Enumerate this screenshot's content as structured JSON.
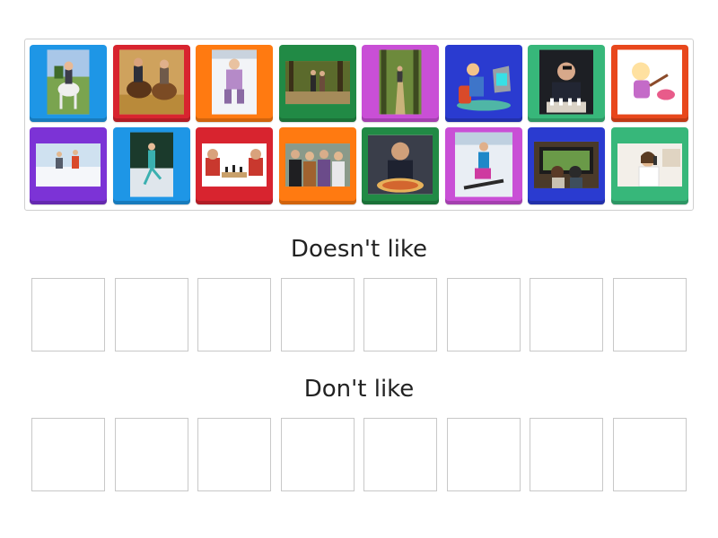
{
  "activity": "Doesn't like / Don't like — group sort",
  "tiles": [
    {
      "name": "tile-horse-riding-girl",
      "icon": "horse-rider-photo-icon",
      "color": "#1e96e6",
      "row": 0
    },
    {
      "name": "tile-horse-riding-couple",
      "icon": "horseback-couple-photo-icon",
      "color": "#d8242f",
      "row": 0
    },
    {
      "name": "tile-ice-skating-child",
      "icon": "ice-skating-child-photo-icon",
      "color": "#ff7a11",
      "row": 0
    },
    {
      "name": "tile-hiking-forest",
      "icon": "forest-hikers-photo-icon",
      "color": "#218a45",
      "row": 0
    },
    {
      "name": "tile-forest-walk",
      "icon": "forest-path-walker-photo-icon",
      "color": "#c94fd6",
      "row": 0
    },
    {
      "name": "tile-cartoon-tv-watcher",
      "icon": "cartoon-tv-couch-icon",
      "color": "#2a3bd0",
      "row": 0
    },
    {
      "name": "tile-chess-player-man",
      "icon": "chess-player-photo-icon",
      "color": "#37b77a",
      "row": 0
    },
    {
      "name": "tile-cartoon-painting-girl",
      "icon": "cartoon-painting-girl-icon",
      "color": "#e8471c",
      "row": 0
    },
    {
      "name": "tile-skiing-kids",
      "icon": "skiing-kids-photo-icon",
      "color": "#7c33d6",
      "row": 1
    },
    {
      "name": "tile-figure-skater",
      "icon": "figure-skater-photo-icon",
      "color": "#1e96e6",
      "row": 1
    },
    {
      "name": "tile-chess-boys",
      "icon": "chess-boys-photo-icon",
      "color": "#d8242f",
      "row": 1
    },
    {
      "name": "tile-friends-table",
      "icon": "friends-group-photo-icon",
      "color": "#ff7a11",
      "row": 1
    },
    {
      "name": "tile-eating-pizza",
      "icon": "eating-pizza-photo-icon",
      "color": "#218a45",
      "row": 1
    },
    {
      "name": "tile-snowboarder",
      "icon": "snowboarder-photo-icon",
      "color": "#c94fd6",
      "row": 1
    },
    {
      "name": "tile-watching-tv-kids",
      "icon": "kids-watching-tv-photo-icon",
      "color": "#2a3bd0",
      "row": 1
    },
    {
      "name": "tile-phone-woman",
      "icon": "woman-on-phone-photo-icon",
      "color": "#37b77a",
      "row": 1
    }
  ],
  "groups": [
    {
      "title": "Doesn't like",
      "slot_count": 8
    },
    {
      "title": "Don't like",
      "slot_count": 8
    }
  ]
}
